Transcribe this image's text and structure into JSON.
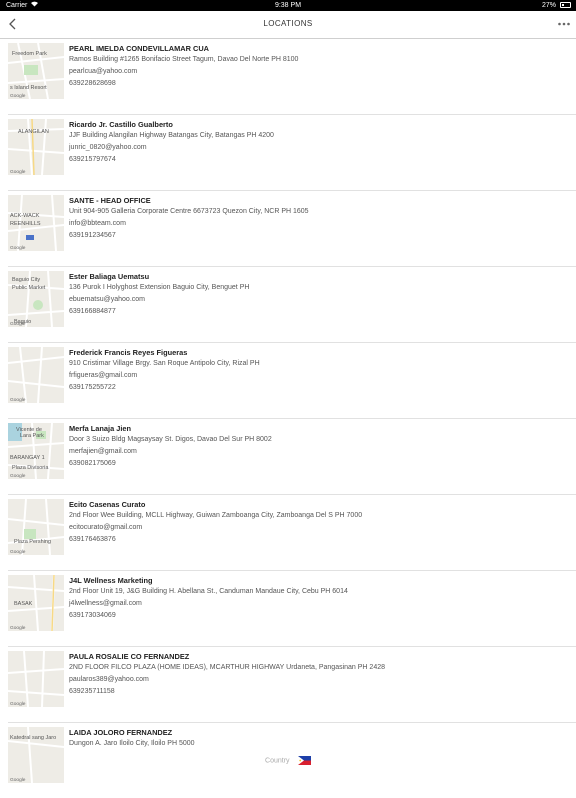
{
  "status_bar": {
    "carrier": "Carrier",
    "time": "9:38 PM",
    "battery": "27%",
    "battery_level": 0.27
  },
  "nav": {
    "title": "LOCATIONS"
  },
  "locations": [
    {
      "name": "PEARL IMELDA CONDEVILLAMAR CUA",
      "address": "Ramos Building #1265 Bonifacio Street  Tagum, Davao Del Norte PH 8100",
      "email": "pearlcua@yahoo.com",
      "phone": "639228628698",
      "map_labels": [
        "Freedom Park",
        "s Island Resort"
      ]
    },
    {
      "name": "Ricardo Jr. Castillo Gualberto",
      "address": "JJF Building Alangilan Highway  Batangas City, Batangas PH 4200",
      "email": "junric_0820@yahoo.com",
      "phone": "639215797674",
      "map_labels": [
        "ALANGILAN"
      ]
    },
    {
      "name": "SANTE - HEAD OFFICE",
      "address": "Unit 904-905 Galleria Corporate Centre 6673723  Quezon City, NCR PH 1605",
      "email": "info@bbteam.com",
      "phone": "639191234567",
      "map_labels": [
        "ACK-WACK",
        "REENHILLS"
      ]
    },
    {
      "name": "Ester Baliaga Uematsu",
      "address": "136 Purok I Holyghost Extension  Baguio City, Benguet PH",
      "email": "ebuematsu@yahoo.com",
      "phone": "639166884877",
      "map_labels": [
        "Baguio City",
        "Public Market",
        "Baguio"
      ]
    },
    {
      "name": "Frederick Francis Reyes Figueras",
      "address": "910 Cristimar Village Brgy. San Roque  Antipolo City, Rizal PH",
      "email": "frfigueras@gmail.com",
      "phone": "639175255722",
      "map_labels": []
    },
    {
      "name": "Merfa Lanaja Jien",
      "address": "Door 3 Suizo Bldg Magsaysay St.  Digos, Davao Del Sur PH 8002",
      "email": "merfajien@gmail.com",
      "phone": "639082175069",
      "map_labels": [
        "Vicente de",
        "Lara Park",
        "BARANGAY 1",
        "Plaza Divisoria"
      ]
    },
    {
      "name": "Ecito Casenas Curato",
      "address": "2nd Floor Wee Building, MCLL Highway, Guiwan  Zamboanga City, Zamboanga Del S PH 7000",
      "email": "ecitocurato@gmail.com",
      "phone": "639176463876",
      "map_labels": [
        "Plaza Pershing"
      ]
    },
    {
      "name": "J4L Wellness Marketing",
      "address": "2nd Floor Unit 19, J&G Building H. Abellana St., Canduman  Mandaue City, Cebu PH 6014",
      "email": "j4lwellness@gmail.com",
      "phone": "639173034069",
      "map_labels": [
        "BASAK"
      ]
    },
    {
      "name": "PAULA ROSALIE CO FERNANDEZ",
      "address": "2ND FLOOR FILCO PLAZA (HOME IDEAS), MCARTHUR HIGHWAY  Urdaneta, Pangasinan PH 2428",
      "email": "paularos389@yahoo.com",
      "phone": "639235711158",
      "map_labels": []
    },
    {
      "name": "LAIDA JOLORO FERNANDEZ",
      "address": "Dungon A. Jaro  Iloilo City, Iloilo PH 5000",
      "email": "",
      "phone": "",
      "map_labels": [
        "Katedral sang Jaro"
      ]
    }
  ],
  "map_attribution": "Google",
  "footer": {
    "country_label": "Country",
    "flag_icon": "philippines-flag-icon"
  },
  "colors": {
    "status_bar": "#000000",
    "map_bg": "#eeece6",
    "map_road": "#ffffff",
    "map_park": "#c8e6c0",
    "map_water": "#aad3df"
  }
}
